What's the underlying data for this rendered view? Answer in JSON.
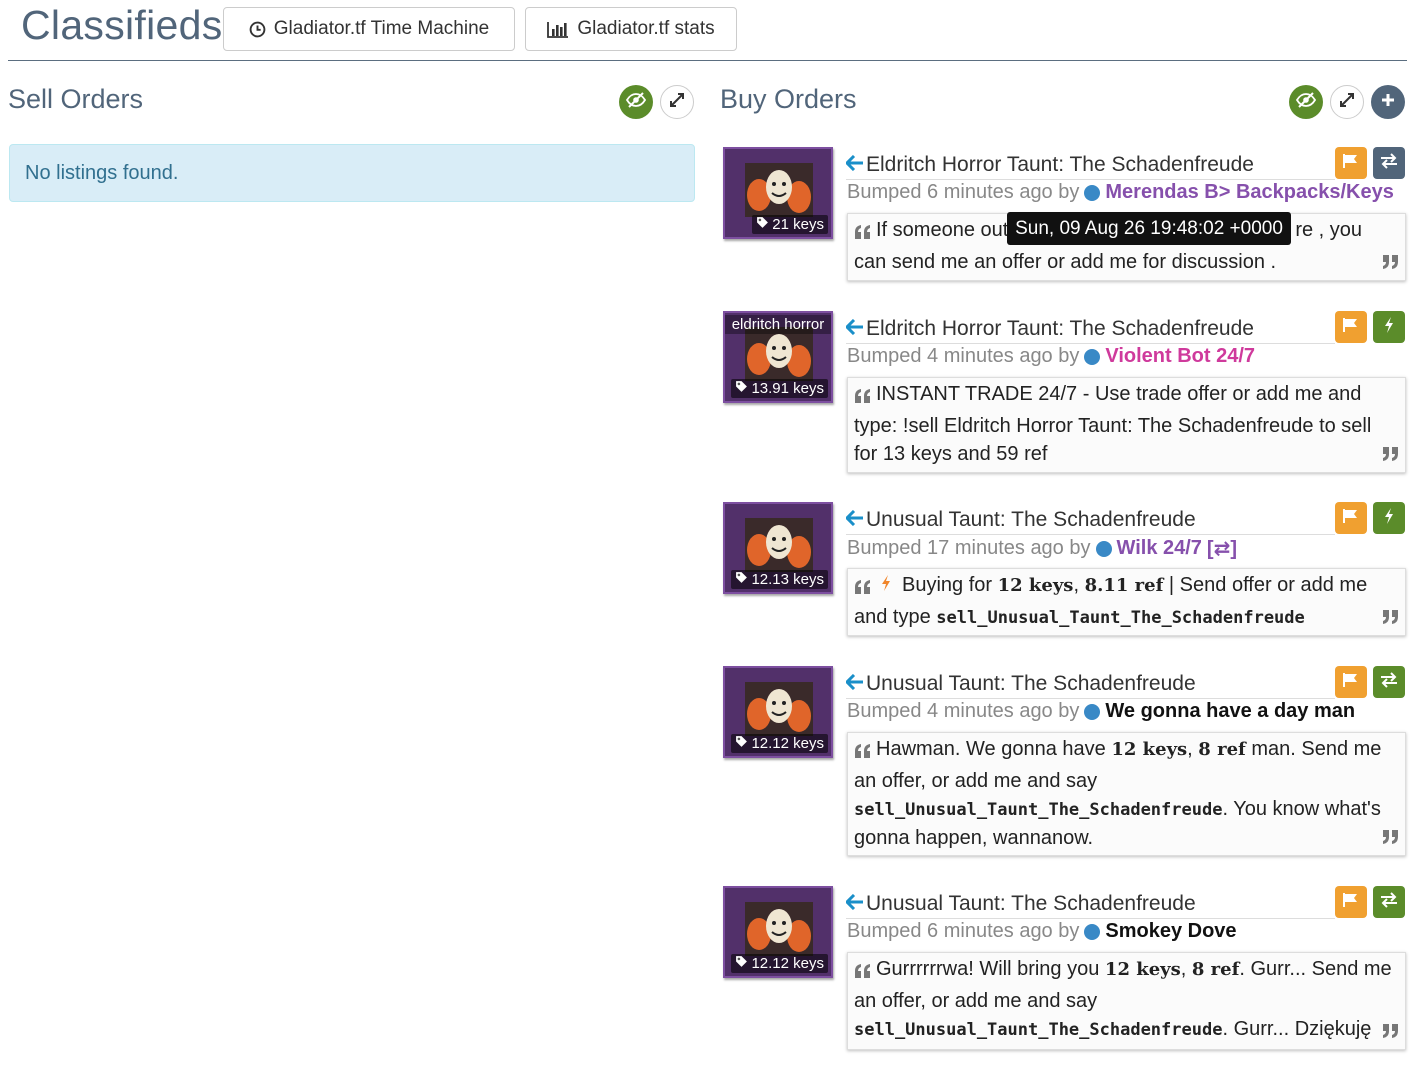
{
  "header": {
    "title": "Classifieds",
    "time_machine": {
      "label": "Gladiator.tf Time Machine",
      "icon": "clock-icon"
    },
    "stats": {
      "label": "Gladiator.tf stats",
      "icon": "bar-chart-icon"
    }
  },
  "sell": {
    "title": "Sell Orders",
    "empty_message": "No listings found."
  },
  "buy": {
    "title": "Buy Orders",
    "listings": [
      {
        "item": "Eldritch Horror Taunt: The Schadenfreude",
        "price": "21 keys",
        "top_label": "",
        "bumped": "Bumped 6 minutes ago by",
        "user": "Merendas B> Backpacks/Keys",
        "action_icon": "exchange-icon",
        "segments": [
          "If someone out",
          "re , you can send me an offer or add me for discussion ."
        ]
      },
      {
        "item": "Eldritch Horror Taunt: The Schadenfreude",
        "price": "13.91 keys",
        "top_label": "eldritch horror",
        "bumped": "Bumped 4 minutes ago by",
        "user": "Violent Bot 24/7",
        "action_icon": "lightning-icon",
        "segments": [
          "INSTANT TRADE 24/7 - Use trade offer or add me and type: !sell Eldritch Horror Taunt: The Schadenfreude to sell for 13 keys and 59 ref"
        ]
      },
      {
        "item": "Unusual Taunt: The Schadenfreude",
        "price": "12.13 keys",
        "top_label": "",
        "bumped": "Bumped 17 minutes ago by",
        "user": "Wilk 24/7",
        "user_suffix": "[⇄]",
        "action_icon": "lightning-icon",
        "segments": [
          "Buying for ",
          "12 keys",
          ", ",
          "8.11 ref",
          " | Send offer or add me and type ",
          "sell_Unusual_Taunt_The_Schadenfreude"
        ]
      },
      {
        "item": "Unusual Taunt: The Schadenfreude",
        "price": "12.12 keys",
        "top_label": "",
        "bumped": "Bumped 4 minutes ago by",
        "user": "We gonna have a day man",
        "action_icon": "exchange-icon",
        "segments": [
          "Hawman. We gonna have ",
          "12 keys",
          ", ",
          "8 ref",
          " man. Send me an offer, or add me and say ",
          "sell_Unusual_Taunt_The_Schadenfreude",
          ". You know what's gonna happen, wannanow."
        ]
      },
      {
        "item": "Unusual Taunt: The Schadenfreude",
        "price": "12.12 keys",
        "top_label": "",
        "bumped": "Bumped 6 minutes ago by",
        "user": "Smokey Dove",
        "action_icon": "exchange-icon",
        "segments": [
          "Gurrrrrrwa! Will bring you ",
          "12 keys",
          ", ",
          "8 ref",
          ". Gurr... Send me an offer, or add me and say ",
          "sell_Unusual_Taunt_The_Schadenfreude",
          ". Gurr... Dziękuję"
        ]
      }
    ]
  },
  "tooltip": "Sun, 09 Aug 26 19:48:02 +0000",
  "colors": {
    "title": "#51657a",
    "green": "#5b8c2a",
    "orange": "#f0a030",
    "info_bg": "#d9edf7",
    "thumb_bg": "#52306a"
  }
}
